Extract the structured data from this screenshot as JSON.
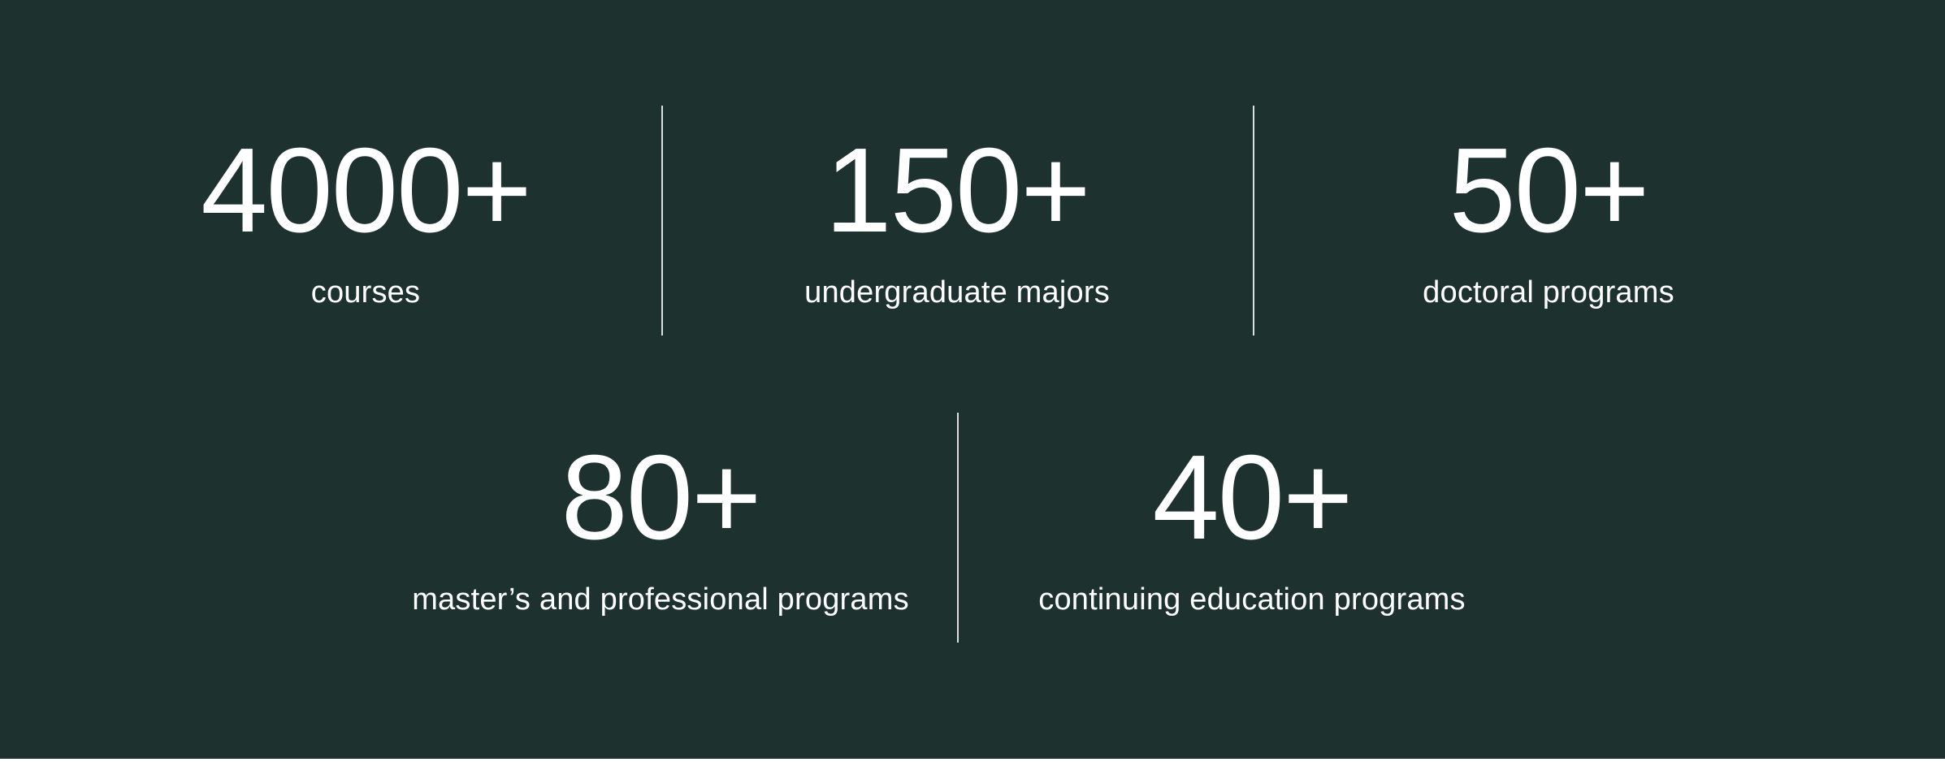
{
  "stats_row_1": [
    {
      "value": "4000+",
      "label": "courses"
    },
    {
      "value": "150+",
      "label": "undergraduate majors"
    },
    {
      "value": "50+",
      "label": "doctoral programs"
    }
  ],
  "stats_row_2": [
    {
      "value": "80+",
      "label": "master’s and professional programs"
    },
    {
      "value": "40+",
      "label": "continuing education programs"
    }
  ],
  "colors": {
    "background": "#1d322e",
    "text": "#ffffff",
    "divider": "#d9e2df"
  }
}
